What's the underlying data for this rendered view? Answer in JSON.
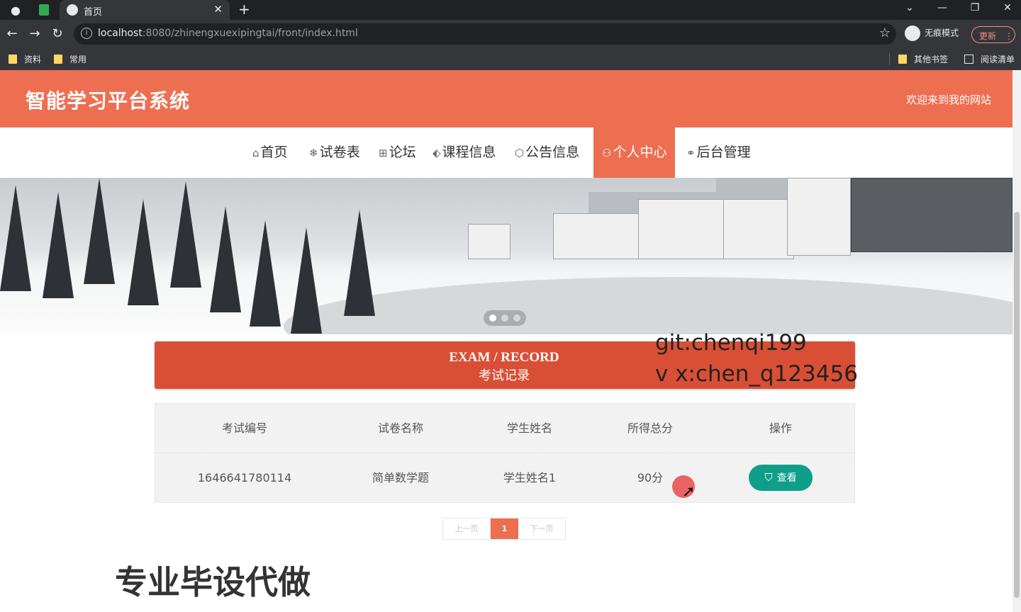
{
  "browser": {
    "tab_title": "首页",
    "url_host": "localhost",
    "url_rest": ":8080/zhinengxuexipingtai/front/index.html",
    "incognito_label": "无痕模式",
    "update_label": "更新",
    "bookmarks": [
      "资料",
      "常用"
    ],
    "other_bookmarks": "其他书签",
    "reading_list": "阅读清单"
  },
  "site": {
    "title": "智能学习平台系统",
    "welcome": "欢迎来到我的网站",
    "accent_color": "#ee6e51"
  },
  "nav": [
    {
      "icon": "⌂",
      "label": "首页"
    },
    {
      "icon": "❄",
      "label": "试卷表"
    },
    {
      "icon": "⊞",
      "label": "论坛"
    },
    {
      "icon": "⬖",
      "label": "课程信息"
    },
    {
      "icon": "⬡",
      "label": "公告信息"
    },
    {
      "icon": "⚇",
      "label": "个人中心",
      "active": true
    },
    {
      "icon": "⚭",
      "label": "后台管理"
    }
  ],
  "section": {
    "title_en": "EXAM / RECORD",
    "title_cn": "考试记录"
  },
  "overlay": {
    "git": "git:chenqi199",
    "vx": "v x:chen_q123456",
    "slogan": "专业毕设代做"
  },
  "table": {
    "columns": [
      "考试编号",
      "试卷名称",
      "学生姓名",
      "所得总分",
      "操作"
    ],
    "rows": [
      {
        "exam_id": "1646641780114",
        "paper": "简单数学题",
        "student": "学生姓名1",
        "score": "90分",
        "action": "查看"
      }
    ]
  },
  "pagination": {
    "prev": "上一页",
    "current": "1",
    "next": "下一页"
  }
}
